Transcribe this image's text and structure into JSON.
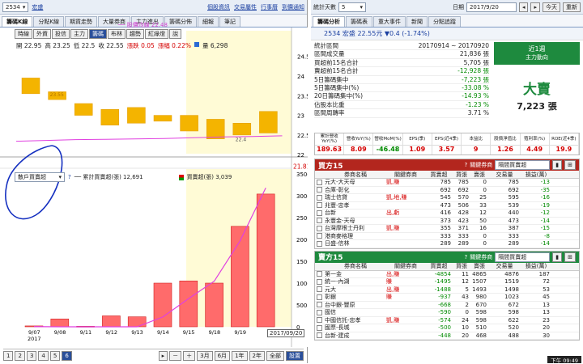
{
  "left": {
    "toplinks": [
      "個股資訊",
      "交易屬性",
      "行事曆",
      "到價通知"
    ],
    "stock_code": "2534",
    "stock_name": "宏盛",
    "tabs": [
      "籌碼K線",
      "分點K線",
      "期貨走勢",
      "大量券商",
      "主力進出",
      "籌碼分佈",
      "細報",
      "筆記"
    ],
    "tools": [
      "時線",
      "外資",
      "投信",
      "主力",
      "籌碼",
      "布林",
      "趨勢",
      "紅綠燈",
      "說"
    ],
    "active_tool": "籌碼",
    "ohlc": {
      "open": "開 22.95",
      "high": "高 23.25",
      "low": "低 22.5",
      "close": "收 22.55",
      "chg_label": "漲跌",
      "chg": "0.05",
      "pct_label": "漲幅",
      "pct": "0.22%",
      "vol": "量 6,298"
    },
    "ma_label": "── 股價均線 22.48",
    "top_price_labels": [
      "24.5",
      "24",
      "23.5",
      "23",
      "22.5",
      "22"
    ],
    "close_marker": "21.81",
    "candle_notes": [
      "23.55",
      "22.4"
    ],
    "lower_select": "散戶買賣超",
    "legend_line": "── 累計買賣超(張) 12,691",
    "legend_bar": "買賣超(張) 3,039",
    "lower_axis": [
      "3500",
      "3000",
      "2500",
      "2000",
      "1500",
      "1000",
      "500",
      "0"
    ],
    "xticks": [
      "9/07",
      "9/08",
      "9/11",
      "9/12",
      "9/13",
      "9/14",
      "9/15",
      "9/18",
      "9/19"
    ],
    "year": "2017",
    "date_box": "2017/09/20",
    "bottom": {
      "pages": [
        "1",
        "2",
        "3",
        "4",
        "5",
        "6"
      ],
      "periods": [
        "3月",
        "6月",
        "1年",
        "2年",
        "全部"
      ],
      "settings": "設置"
    }
  },
  "chart_data": [
    {
      "type": "bar",
      "title": "",
      "categories": [
        "9/07",
        "9/08",
        "9/11",
        "9/12",
        "9/13",
        "9/14",
        "9/15",
        "9/18",
        "9/19",
        "9/20"
      ],
      "series": [
        {
          "name": "",
          "values": [
            20,
            -300,
            -20,
            250,
            -380,
            1000,
            1050,
            1000,
            2300,
            3039
          ]
        }
      ],
      "ylim": [
        0,
        3500
      ]
    },
    {
      "type": "line",
      "series": [
        {
          "name": "累計買賣超(張)",
          "values": [
            12,
            -290,
            -310,
            -60,
            -440,
            560,
            1610,
            2610,
            4910,
            7950
          ]
        }
      ]
    }
  ],
  "right": {
    "stat_label": "統計天數",
    "stat_value": "5",
    "date_label": "日期",
    "date_value": "2017/9/20",
    "today_btn": "今天",
    "refresh_btn": "重新",
    "tabs": [
      "籌碼分析",
      "籌碼表",
      "重大事件",
      "新聞",
      "分點追蹤"
    ],
    "title": "2534 宏盛 22.55元 ▼0.4 (-1.74%)",
    "rows": [
      [
        "統計區間",
        "20170914 ~ 20170920"
      ],
      [
        "區間成交量",
        "21,836 張"
      ],
      [
        "買超前15名合計",
        "5,705 張"
      ],
      [
        "賣超前15名合計",
        "-12,928 張"
      ],
      [
        "5日籌碼集中",
        "-7,223 張"
      ],
      [
        "5日籌碼集中(%)",
        "-33.08 %"
      ],
      [
        "20日籌碼集中(%)",
        "-14.93 %"
      ],
      [
        "佔股本比重",
        "-1.23 %"
      ],
      [
        "區間周轉率",
        "3.71 %"
      ]
    ],
    "side_top": "近1週",
    "side_sub": "主力動向",
    "side_big": "大賣",
    "side_num": "7,223 張",
    "metrics_head": [
      "累計營收YoY(%)",
      "營收YoY(%)",
      "營收MoM(%)",
      "EPS(季)",
      "EPS(近4季)",
      "本益比",
      "股價淨值比",
      "殖利率(%)",
      "ROE(近4季)"
    ],
    "metrics_val": [
      "189.63",
      "8.09",
      "-46.48",
      "1.09",
      "3.57",
      "9",
      "1.26",
      "4.49",
      "19.9"
    ],
    "buy_title": "買方15",
    "sell_title": "賣方15",
    "broker_filter": "關鍵券商",
    "broker_select": "隔間買賣超",
    "buy_head": [
      "券商名稱",
      "關鍵券商",
      "買賣超",
      "買張",
      "賣張",
      "交易量",
      "損益(萬)"
    ],
    "buy_rows": [
      [
        "元大-大天母",
        "凱,賺",
        "785",
        "785",
        "0",
        "785",
        "-13"
      ],
      [
        "合庫-彰化",
        "",
        "692",
        "692",
        "0",
        "692",
        "-35"
      ],
      [
        "瑞士信貸",
        "凱,地,賺",
        "545",
        "570",
        "25",
        "595",
        "-16"
      ],
      [
        "兆豐-忠孝",
        "",
        "473",
        "506",
        "33",
        "539",
        "-19"
      ],
      [
        "台新",
        "出,虧",
        "416",
        "428",
        "12",
        "440",
        "-12"
      ],
      [
        "永豐金-天母",
        "",
        "373",
        "423",
        "50",
        "473",
        "-14"
      ],
      [
        "台灣摩根士丹利",
        "凱,賺",
        "355",
        "371",
        "16",
        "387",
        "-15"
      ],
      [
        "港商麥格理",
        "",
        "333",
        "333",
        "0",
        "333",
        "-8"
      ],
      [
        "日盛-信林",
        "",
        "289",
        "289",
        "0",
        "289",
        "-14"
      ]
    ],
    "sell_head": [
      "券商名稱",
      "關鍵券商",
      "買賣超",
      "買張",
      "賣張",
      "交易量",
      "損益(萬)"
    ],
    "sell_rows": [
      [
        "第一金",
        "出,賺",
        "-4854",
        "11",
        "4865",
        "4876",
        "187"
      ],
      [
        "統一-內湖",
        "賺",
        "-1495",
        "12",
        "1507",
        "1519",
        "72"
      ],
      [
        "元大",
        "出,賺",
        "-1488",
        "5",
        "1493",
        "1498",
        "53"
      ],
      [
        "彰銀",
        "賺",
        "-937",
        "43",
        "980",
        "1023",
        "45"
      ],
      [
        "台中銀-豐原",
        "",
        "-668",
        "2",
        "670",
        "672",
        "13"
      ],
      [
        "國信",
        "",
        "-590",
        "0",
        "598",
        "598",
        "13"
      ],
      [
        "中國信託-忠孝",
        "凱,賺",
        "-574",
        "24",
        "598",
        "622",
        "23"
      ],
      [
        "國票-長城",
        "",
        "-500",
        "10",
        "510",
        "520",
        "20"
      ],
      [
        "台新-建成",
        "",
        "-448",
        "20",
        "468",
        "488",
        "30"
      ]
    ],
    "clock": "下午 09:49"
  }
}
